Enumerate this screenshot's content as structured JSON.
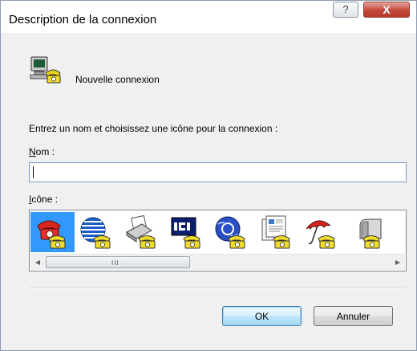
{
  "window": {
    "title": "Description de la connexion",
    "help_glyph": "?",
    "close_glyph": "X"
  },
  "connection": {
    "name": "Nouvelle connexion",
    "icon": "computer-phone-icon"
  },
  "form": {
    "instructions": "Entrez un nom et choisissez une icône pour la connexion :",
    "name_label_mnemonic": "N",
    "name_label_rest": "om :",
    "name_value": "",
    "icon_label_mnemonic": "I",
    "icon_label_rest": "cône :"
  },
  "icons": [
    {
      "name": "red-phone-icon",
      "selected": true
    },
    {
      "name": "globe-phone-icon",
      "selected": false
    },
    {
      "name": "fax-phone-icon",
      "selected": false
    },
    {
      "name": "mci-phone-icon",
      "selected": false
    },
    {
      "name": "ge-globe-phone-icon",
      "selected": false
    },
    {
      "name": "document-phone-icon",
      "selected": false
    },
    {
      "name": "umbrella-phone-icon",
      "selected": false
    },
    {
      "name": "mailbox-phone-icon",
      "selected": false
    }
  ],
  "scrollbar": {
    "left_arrow": "◀",
    "right_arrow": "▶",
    "grip": "III"
  },
  "buttons": {
    "ok": "OK",
    "cancel": "Annuler"
  },
  "colors": {
    "selection": "#3399ff",
    "close_button": "#c4483a"
  }
}
